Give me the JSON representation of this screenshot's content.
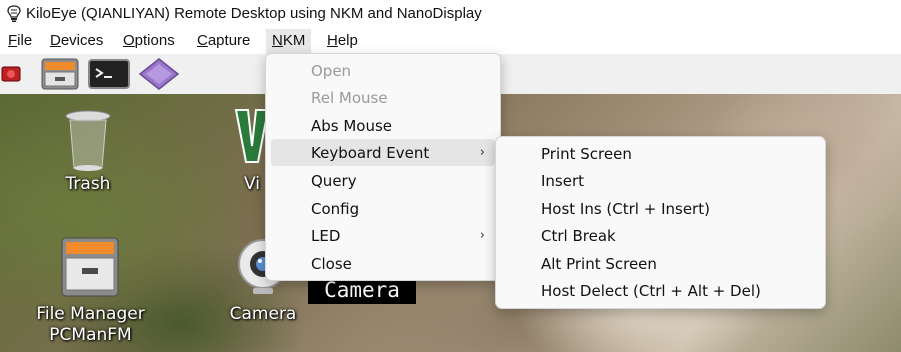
{
  "window": {
    "title": "KiloEye (QIANLIYAN) Remote Desktop using NKM and NanoDisplay"
  },
  "menubar": {
    "items": [
      {
        "mnemonic": "F",
        "rest": "ile"
      },
      {
        "mnemonic": "D",
        "rest": "evices"
      },
      {
        "mnemonic": "O",
        "rest": "ptions"
      },
      {
        "mnemonic": "C",
        "rest": "apture"
      },
      {
        "mnemonic": "N",
        "rest": "KM"
      },
      {
        "mnemonic": "H",
        "rest": "elp"
      }
    ]
  },
  "nkm_menu": {
    "items": [
      {
        "label": "Open",
        "enabled": false,
        "submenu": false
      },
      {
        "label": "Rel Mouse",
        "enabled": false,
        "submenu": false
      },
      {
        "label": "Abs Mouse",
        "enabled": true,
        "submenu": false
      },
      {
        "label": "Keyboard Event",
        "enabled": true,
        "submenu": true,
        "highlighted": true
      },
      {
        "label": "Query",
        "enabled": true,
        "submenu": false
      },
      {
        "label": "Config",
        "enabled": true,
        "submenu": false
      },
      {
        "label": "LED",
        "enabled": true,
        "submenu": true
      },
      {
        "label": "Close",
        "enabled": true,
        "submenu": false
      }
    ],
    "submenu_arrow": "›"
  },
  "keyboard_event_submenu": {
    "items": [
      {
        "label": "Print Screen"
      },
      {
        "label": "Insert"
      },
      {
        "label": "Host Ins (Ctrl + Insert)"
      },
      {
        "label": "Ctrl Break"
      },
      {
        "label": "Alt Print Screen"
      },
      {
        "label": "Host Delect (Ctrl + Alt + Del)"
      }
    ]
  },
  "desktop": {
    "icons": {
      "trash": {
        "label": "Trash"
      },
      "file_manager": {
        "label_line1": "File Manager",
        "label_line2": "PCManFM"
      },
      "camera": {
        "label": "Camera"
      },
      "vi_partial": {
        "label": "Vi"
      }
    },
    "camera_label_box": "Camera"
  },
  "toolbar": {
    "buttons": [
      "record-icon",
      "file-cabinet-icon",
      "terminal-icon",
      "diamond-app-icon"
    ]
  }
}
